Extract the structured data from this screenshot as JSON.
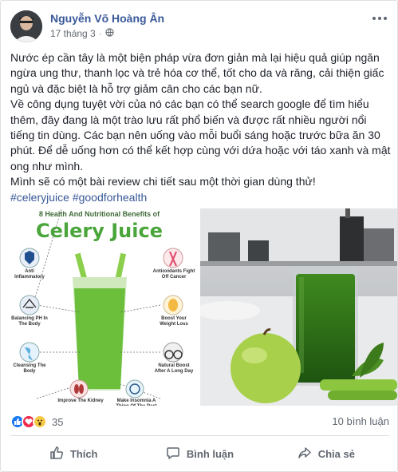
{
  "post": {
    "author": "Nguyễn Võ Hoàng Ân",
    "date": "17 tháng 3",
    "privacy_icon": "globe-icon",
    "paragraph1": "Nước ép cần tây là một biện pháp vừa đơn giản mà lại hiệu quả giúp ngăn ngừa ung thư, thanh lọc và trẻ hóa cơ thể, tốt cho da và răng, cải thiện giấc ngủ và đặc biệt là hỗ trợ giảm cân cho các bạn nữ.",
    "paragraph2": "Về công dụng tuyệt vời của nó các bạn có thể search google để tìm hiểu thêm, đây đang là một trào lưu rất phổ biến và được rất nhiều người nổi tiếng tin dùng. Các bạn nên uống vào mỗi buổi sáng hoặc trước bữa ăn 30 phút. Để dễ uống hơn có thể kết hợp cùng với dứa hoặc với táo xanh và mật ong như mình.",
    "paragraph3": "Mình sẽ có một bài review chi tiết sau một thời gian dùng thử!",
    "hashtag1": "#celeryjuice",
    "hashtag2": "#goodforhealth"
  },
  "infographic": {
    "subtitle": "8 Health And Nutritional Benefits of",
    "title": "Celery Juice",
    "benefits": {
      "b1": "Anti Inflammatory",
      "b2": "Antioxidants Fight Off Cancer",
      "b3": "Balancing PH In The Body",
      "b4": "Boost Your Weight Loss",
      "b5": "Natural Boost After A Long Day",
      "b6": "Cleansing The Body",
      "b7": "Improve The Kidney",
      "b8": "Make Insomnia A Thing Of The Past"
    },
    "colors": {
      "green": "#4aa53a",
      "juice": "#6bbf3b"
    }
  },
  "stats": {
    "reaction_count": "35",
    "comment_count": "10 bình luận"
  },
  "actions": {
    "like": "Thích",
    "comment": "Bình luận",
    "share": "Chia sẻ"
  }
}
